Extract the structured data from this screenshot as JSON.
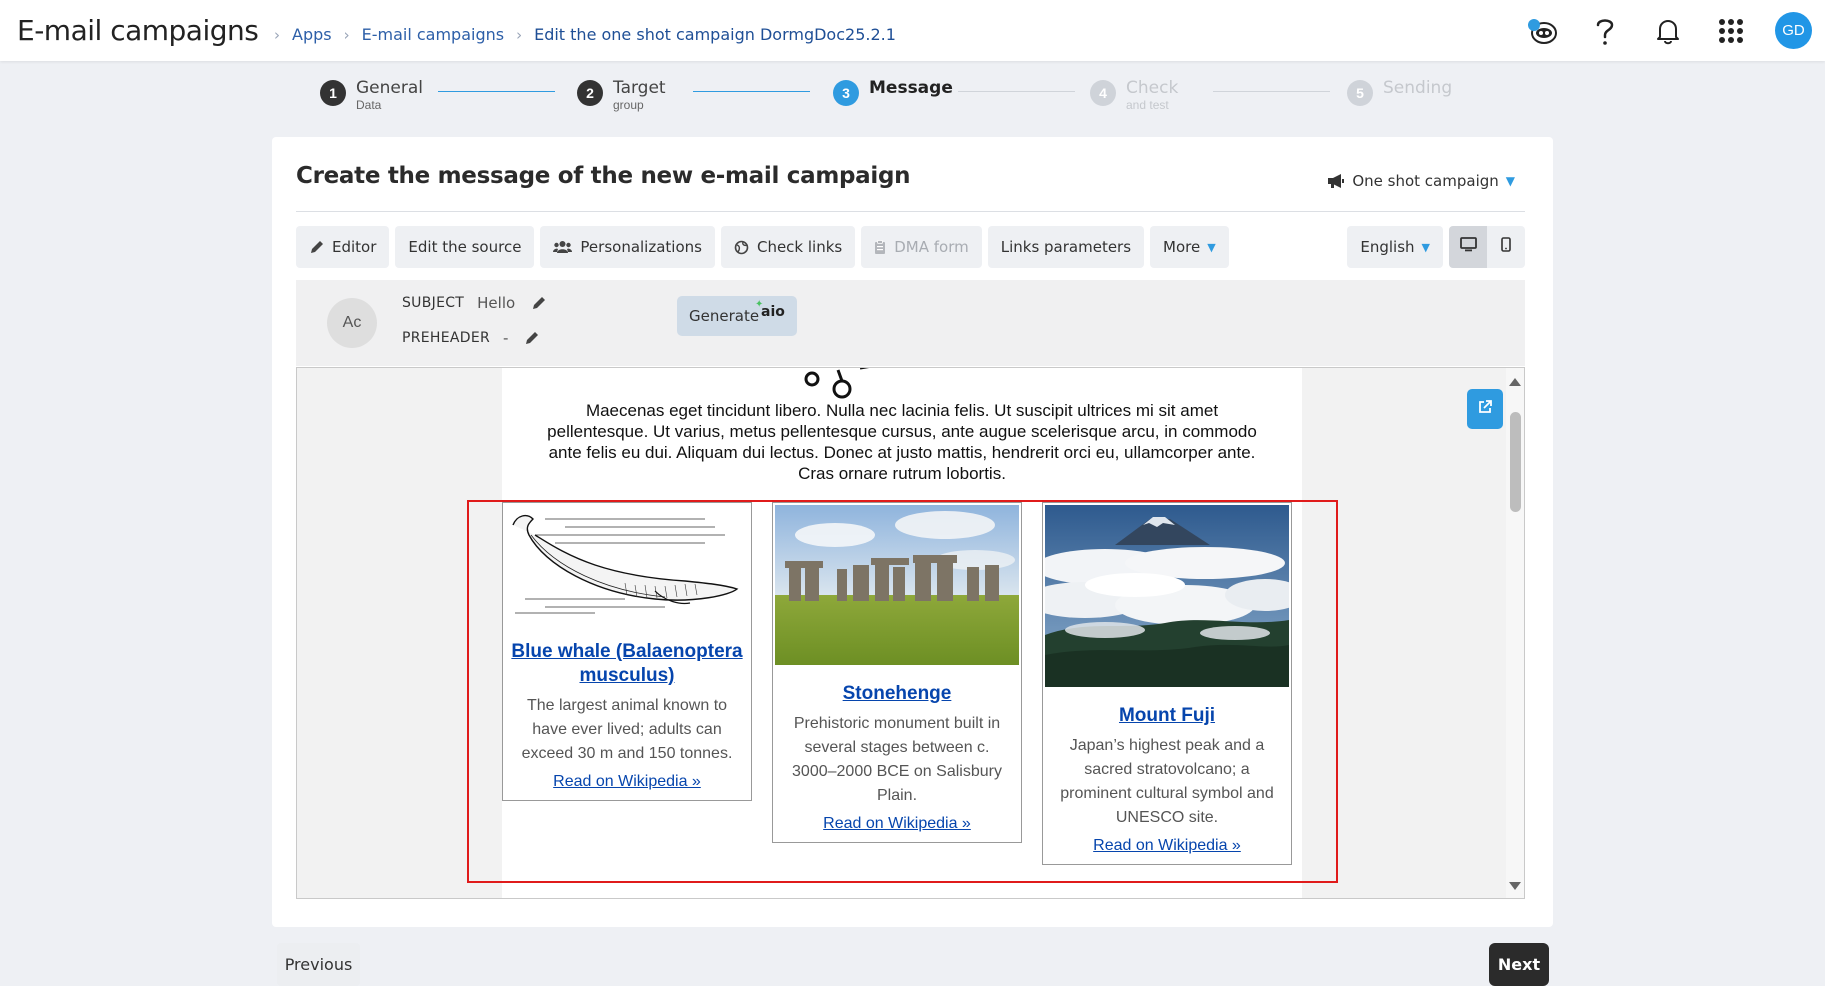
{
  "header": {
    "app_title": "E-mail campaigns",
    "breadcrumb": [
      "Apps",
      "E-mail campaigns",
      "Edit the one shot campaign DormgDoc25.2.1"
    ],
    "icons": [
      "assistant-icon",
      "help-icon",
      "bell-icon",
      "apps-grid-icon"
    ],
    "user_initials": "GD",
    "accent_color": "#2196e6"
  },
  "stepper": {
    "steps": [
      {
        "num": "1",
        "label": "General",
        "sub": "Data",
        "state": "done"
      },
      {
        "num": "2",
        "label": "Target",
        "sub": "group",
        "state": "done"
      },
      {
        "num": "3",
        "label": "Message",
        "sub": "",
        "state": "active"
      },
      {
        "num": "4",
        "label": "Check",
        "sub": "and test",
        "state": "todo"
      },
      {
        "num": "5",
        "label": "Sending",
        "sub": "",
        "state": "todo"
      }
    ]
  },
  "card": {
    "title": "Create the message of the new e-mail campaign",
    "campaign_type": "One shot campaign"
  },
  "toolbar": {
    "editor": "Editor",
    "edit_source": "Edit the source",
    "personalizations": "Personalizations",
    "check_links": "Check links",
    "dma_form": "DMA form",
    "links_parameters": "Links parameters",
    "more": "More",
    "language": "English"
  },
  "subject": {
    "avatar_initials": "Ac",
    "subject_label": "SUBJECT",
    "subject_value": "Hello",
    "preheader_label": "PREHEADER",
    "preheader_value": "-",
    "generate_label": "Generate",
    "aio_label": "aio"
  },
  "email": {
    "intro": "Maecenas eget tincidunt libero. Nulla nec lacinia felis. Ut suscipit ultrices mi sit amet pellentesque. Ut varius, metus pellentesque cursus, ante augue scelerisque arcu, in commodo ante felis eu dui. Aliquam dui lectus. Donec at justo mattis, hendrerit orci eu, ullamcorper ante. Cras ornare rutrum lobortis.",
    "cards": [
      {
        "title": "Blue whale (Balaenoptera musculus)",
        "desc": "The largest animal known to have ever lived; adults can exceed 30 m and 150 tonnes.",
        "link": "Read on Wikipedia »"
      },
      {
        "title": "Stonehenge",
        "desc": "Prehistoric monument built in several stages between c. 3000–2000 BCE on Salisbury Plain.",
        "link": "Read on Wikipedia »"
      },
      {
        "title": "Mount Fuji",
        "desc": "Japan’s highest peak and a sacred stratovolcano; a prominent cultural symbol and UNESCO site.",
        "link": "Read on Wikipedia »"
      }
    ]
  },
  "nav": {
    "previous": "Previous",
    "next": "Next"
  }
}
